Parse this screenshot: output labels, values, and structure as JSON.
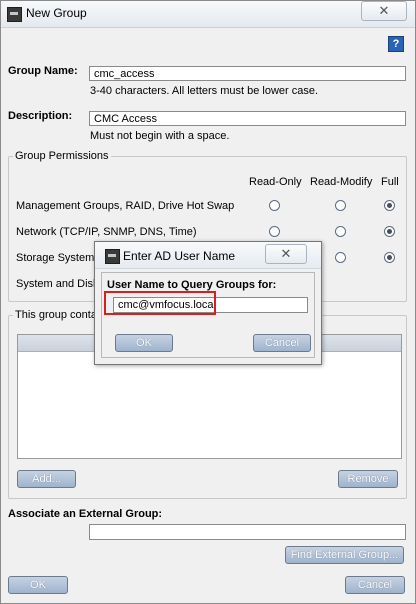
{
  "window": {
    "title": "New Group",
    "close_glyph": "✕"
  },
  "help": {
    "glyph": "?"
  },
  "group_name": {
    "label": "Group Name:",
    "value": "cmc_access",
    "hint": "3-40 characters. All letters must be lower case."
  },
  "description": {
    "label": "Description:",
    "value": "CMC Access",
    "hint": "Must not begin with a space."
  },
  "permissions": {
    "legend": "Group Permissions",
    "columns": [
      "Read-Only",
      "Read-Modify",
      "Full"
    ],
    "rows": [
      {
        "label": "Management Groups, RAID, Drive Hot Swap",
        "selected": "Full"
      },
      {
        "label": "Network (TCP/IP, SNMP, DNS, Time)",
        "selected": "Full"
      },
      {
        "label": "Storage System",
        "selected": "Full"
      },
      {
        "label": "System and Disk",
        "selected": "Full"
      }
    ]
  },
  "members": {
    "legend": "This group conta",
    "add_label": "Add...",
    "remove_label": "Remove"
  },
  "external": {
    "label": "Associate an External Group:",
    "value": "",
    "find_label": "Find External Group..."
  },
  "footer": {
    "ok_label": "OK",
    "cancel_label": "Cancel"
  },
  "dialog": {
    "title": "Enter AD User Name",
    "close_glyph": "✕",
    "field_label": "User Name to Query Groups for:",
    "value": "cmc@vmfocus.local",
    "ok_label": "OK",
    "cancel_label": "Cancel",
    "highlight_color": "#d81e1e"
  }
}
